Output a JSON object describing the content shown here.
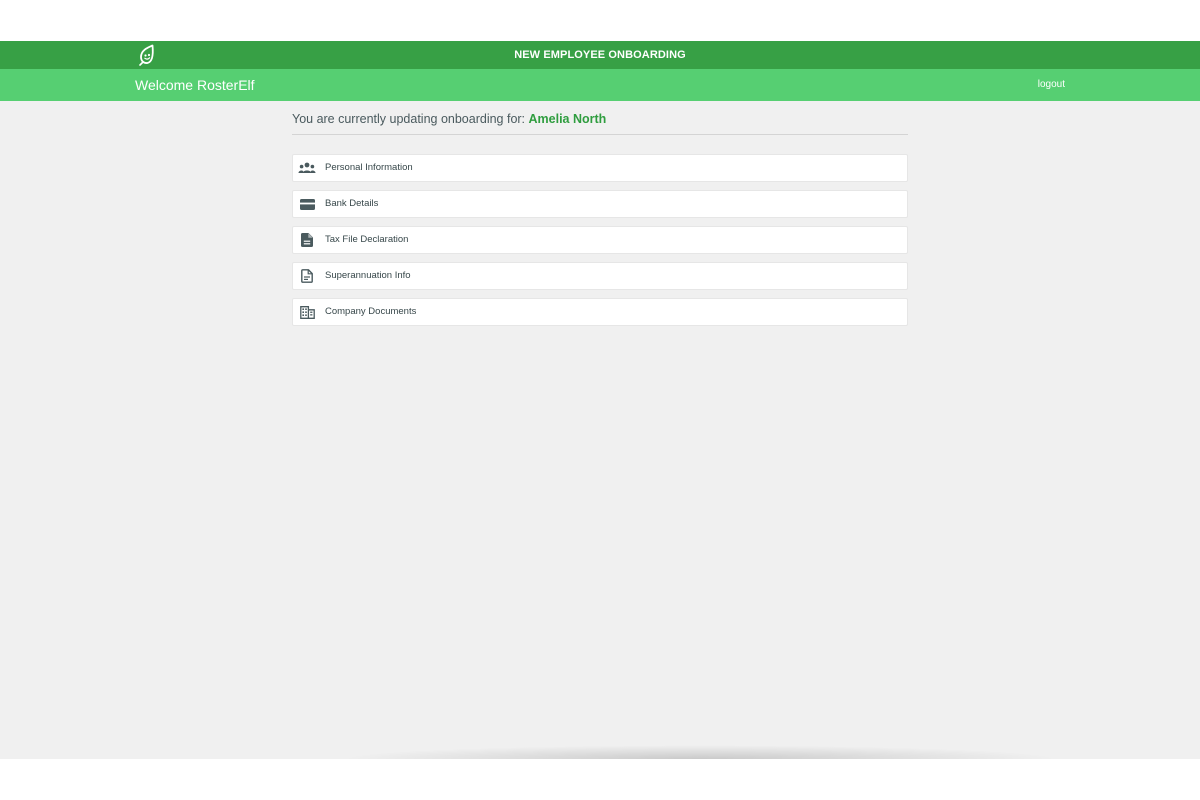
{
  "header": {
    "title": "NEW EMPLOYEE ONBOARDING",
    "logo_icon": "rosterelf-leaf-logo-icon",
    "brand_color": "#37a045"
  },
  "welcome_bar": {
    "welcome_text": "Welcome RosterElf",
    "logout_label": "logout",
    "color": "#56cf72"
  },
  "main": {
    "updating_prefix": "You are currently updating onboarding for: ",
    "employee_name": "Amelia North",
    "menu_items": [
      {
        "label": "Personal Information",
        "icon": "users-icon"
      },
      {
        "label": "Bank Details",
        "icon": "credit-card-icon"
      },
      {
        "label": "Tax File Declaration",
        "icon": "document-filled-icon"
      },
      {
        "label": "Superannuation Info",
        "icon": "document-outline-icon"
      },
      {
        "label": "Company Documents",
        "icon": "building-icon"
      }
    ]
  }
}
